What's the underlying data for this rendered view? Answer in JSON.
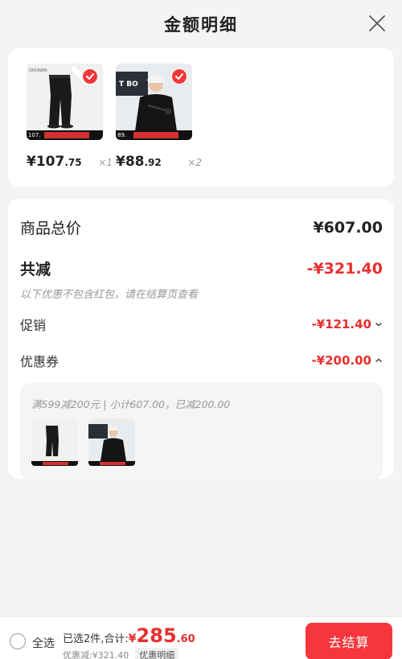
{
  "header": {
    "title": "金额明细"
  },
  "products": [
    {
      "price_int": "¥107",
      "price_dec": ".75",
      "qty": "×1",
      "tag": "107."
    },
    {
      "price_int": "¥88",
      "price_dec": ".92",
      "qty": "×2",
      "tag": "89."
    }
  ],
  "summary": {
    "total_label": "商品总价",
    "total_value": "¥607.00",
    "minus_label": "共减",
    "minus_value": "-¥321.40",
    "note": "以下优惠不包含红包，请在结算页查看",
    "promo_label": "促销",
    "promo_value": "-¥121.40",
    "coupon_label": "优惠券",
    "coupon_value": "-¥200.00",
    "coupon_desc": "满599减200元 | 小计607.00，已减200.00"
  },
  "footer": {
    "select_all": "全选",
    "selected_text": "已选2件,合计:",
    "amount_yen": "¥",
    "amount_int": "285",
    "amount_dec": ".60",
    "saved_text": "优惠减:¥321.40",
    "detail_label": "优惠明细",
    "checkout_label": "去结算"
  },
  "colors": {
    "accent": "#e8302f",
    "checkout_bg": "#f5363c"
  }
}
